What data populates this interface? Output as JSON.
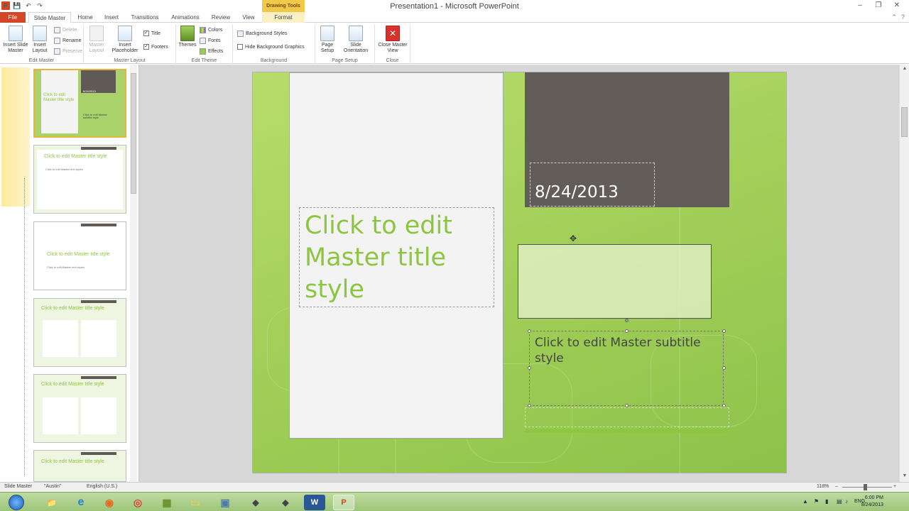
{
  "window": {
    "title": "Presentation1 - Microsoft PowerPoint",
    "context_header": "Drawing Tools",
    "minimize": "–",
    "restore": "❐",
    "close": "✕"
  },
  "quick_access": {
    "logo": "P",
    "save": "💾",
    "undo": "↶",
    "redo": "↷"
  },
  "tabs": [
    {
      "label": "File"
    },
    {
      "label": "Slide Master"
    },
    {
      "label": "Home"
    },
    {
      "label": "Insert"
    },
    {
      "label": "Transitions"
    },
    {
      "label": "Animations"
    },
    {
      "label": "Review"
    },
    {
      "label": "View"
    },
    {
      "label": "Format"
    }
  ],
  "tab_right": {
    "minimize_ribbon": "⌃",
    "help": "?"
  },
  "ribbon": {
    "edit_master": {
      "label": "Edit Master",
      "insert_slide_master": "Insert Slide Master",
      "insert_layout": "Insert Layout",
      "delete": "Delete",
      "rename": "Rename",
      "preserve": "Preserve"
    },
    "master_layout": {
      "label": "Master Layout",
      "master_layout_btn": "Master Layout",
      "insert_placeholder": "Insert Placeholder",
      "title_check": "Title",
      "footers_check": "Footers",
      "check_mark": "✓"
    },
    "edit_theme": {
      "label": "Edit Theme",
      "themes": "Themes",
      "colors": "Colors",
      "fonts": "Fonts",
      "effects": "Effects"
    },
    "background": {
      "label": "Background",
      "background_styles": "Background Styles",
      "hide_background_graphics": "Hide Background Graphics"
    },
    "page_setup": {
      "label": "Page Setup",
      "page_setup_btn": "Page Setup",
      "slide_orientation": "Slide Orientation"
    },
    "close": {
      "label": "Close",
      "close_master_view": "Close Master View",
      "close_icon": "✕"
    }
  },
  "thumbnails": [
    {
      "title": "Click to edit Master title style",
      "subtitle": "Click to edit Master subtitle style",
      "date": "8/24/2013"
    },
    {
      "title": "Click to edit Master title style",
      "body": "Click to edit Master text styles"
    },
    {
      "title": "Click to edit Master title style",
      "body": "Click to edit Master text styles"
    },
    {
      "title": "Click to edit Master title style",
      "body": "Click to edit Master text styles"
    },
    {
      "title": "Click to edit Master title style",
      "body": "Click to edit Master text styles"
    },
    {
      "title": "Click to edit Master title style"
    }
  ],
  "slide": {
    "date": "8/24/2013",
    "title": "Click to edit Master title style",
    "subtitle": "Click to edit Master subtitle style",
    "move_cursor": "✥"
  },
  "scrollbar": {
    "up": "▲",
    "down": "▼"
  },
  "statusbar": {
    "view": "Slide Master",
    "theme": "\"Austin\"",
    "language": "English (U.S.)",
    "zoom": "118%",
    "zoom_minus": "–",
    "zoom_plus": "+"
  },
  "taskbar": {
    "apps": [
      {
        "name": "File Explorer",
        "glyph": "📁",
        "color": "#e8c35a"
      },
      {
        "name": "Internet Explorer",
        "glyph": "e",
        "color": "#2a7fd4"
      },
      {
        "name": "Firefox",
        "glyph": "◉",
        "color": "#e66a1e"
      },
      {
        "name": "Chrome",
        "glyph": "◎",
        "color": "#d9423b"
      },
      {
        "name": "App",
        "glyph": "▦",
        "color": "#6a8f2a"
      },
      {
        "name": "App",
        "glyph": "▭",
        "color": "#f0e070"
      },
      {
        "name": "App",
        "glyph": "▣",
        "color": "#4a7ab0"
      },
      {
        "name": "App",
        "glyph": "◆",
        "color": "#444"
      },
      {
        "name": "App",
        "glyph": "◆",
        "color": "#444"
      },
      {
        "name": "Word",
        "glyph": "W",
        "color": "#2b5797"
      },
      {
        "name": "PowerPoint",
        "glyph": "P",
        "color": "#d24726"
      }
    ],
    "language": "ENG",
    "time": "6:00 PM",
    "date": "8/24/2013"
  }
}
